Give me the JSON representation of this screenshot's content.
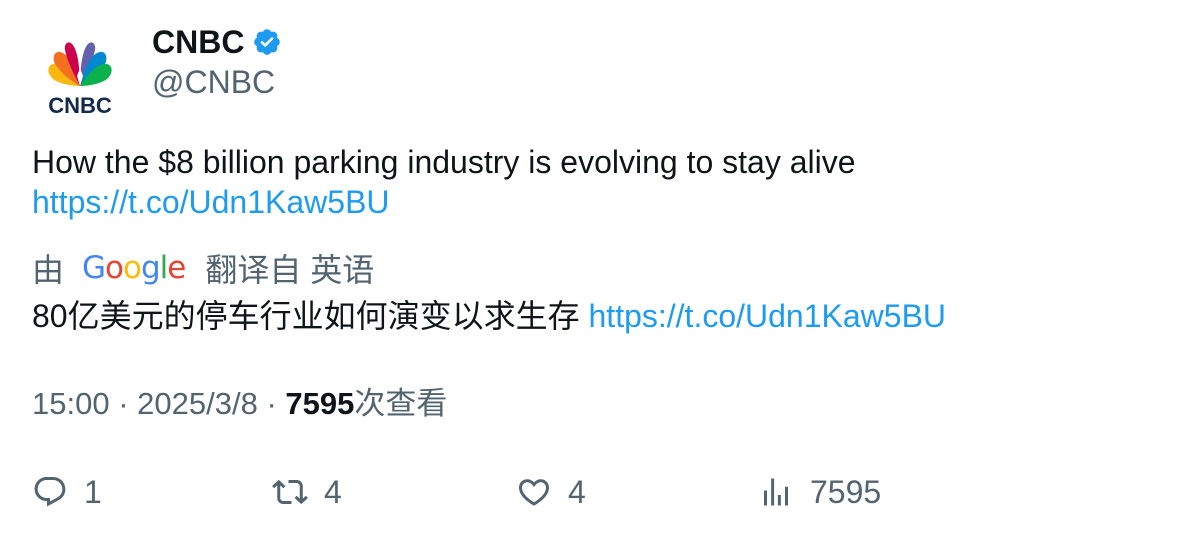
{
  "author": {
    "display_name": "CNBC",
    "handle": "@CNBC",
    "verified_icon": "verified-badge-icon",
    "avatar_logo_text": "CNBC"
  },
  "tweet": {
    "text": "How the $8 billion parking industry is evolving to stay alive",
    "link": "https://t.co/Udn1Kaw5BU"
  },
  "translation": {
    "by_label": "由",
    "provider": "Google",
    "from_label": "翻译自 英语",
    "text": "80亿美元的停车行业如何演变以求生存",
    "link": "https://t.co/Udn1Kaw5BU"
  },
  "meta": {
    "time": "15:00",
    "separator": "·",
    "date": "2025/3/8",
    "views_count": "7595",
    "views_label": "次查看"
  },
  "actions": {
    "reply_count": "1",
    "retweet_count": "4",
    "like_count": "4",
    "views_count": "7595"
  },
  "colors": {
    "link": "#1d9bf0",
    "secondary_text": "#536471",
    "primary_text": "#0f1419",
    "verified": "#1d9bf0"
  }
}
